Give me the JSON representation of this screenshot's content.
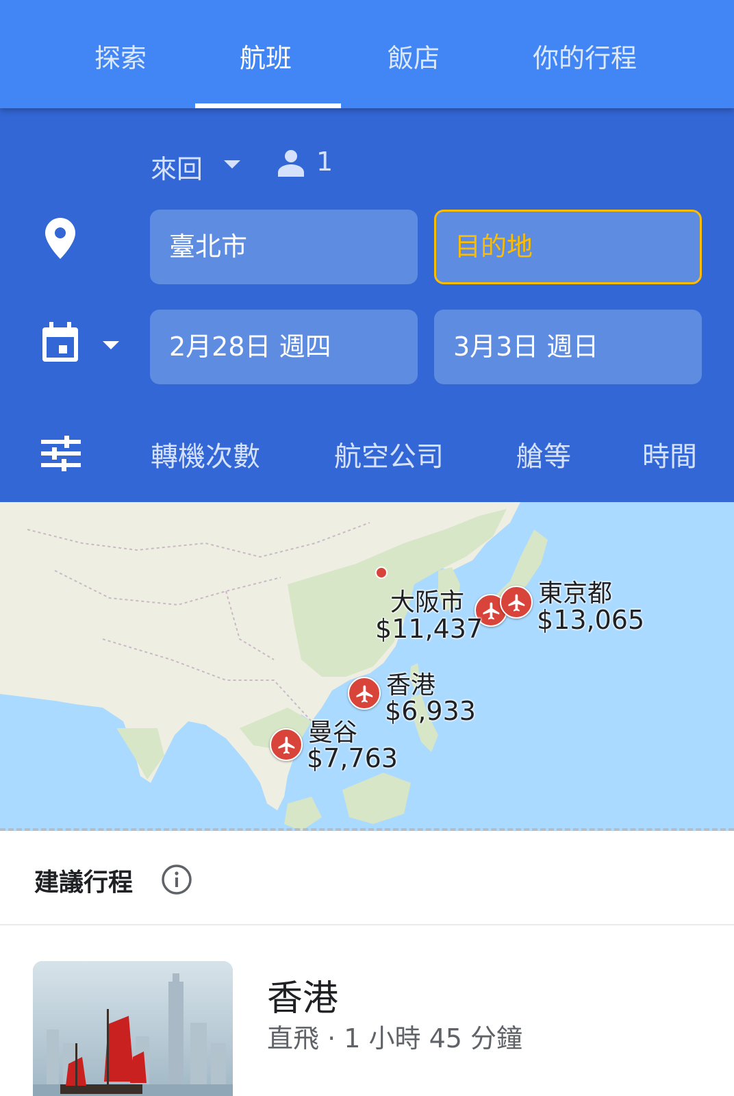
{
  "tabs": [
    {
      "label": "探索",
      "active": false
    },
    {
      "label": "航班",
      "active": true
    },
    {
      "label": "飯店",
      "active": false
    },
    {
      "label": "你的行程",
      "active": false
    }
  ],
  "search": {
    "trip_type": "來回",
    "passengers": "1",
    "origin": "臺北市",
    "destination_placeholder": "目的地",
    "depart_date": "2月28日 週四",
    "return_date": "3月3日 週日"
  },
  "filters": [
    "轉機次數",
    "航空公司",
    "艙等",
    "時間"
  ],
  "map": {
    "destinations": [
      {
        "city": "大阪市",
        "price": "$11,437"
      },
      {
        "city": "東京都",
        "price": "$13,065"
      },
      {
        "city": "香港",
        "price": "$6,933"
      },
      {
        "city": "曼谷",
        "price": "$7,763"
      }
    ]
  },
  "suggestions": {
    "title": "建議行程",
    "items": [
      {
        "name": "香港",
        "meta": "直飛 · 1 小時 45 分鐘"
      }
    ]
  },
  "colors": {
    "tabbar": "#4285f4",
    "panel": "#3367d6",
    "field": "#5e8ce0",
    "destination_accent": "#fbbc05",
    "pin": "#d9443a",
    "sea": "#aadaff"
  },
  "icons": {
    "location": "location-pin-icon",
    "calendar": "calendar-icon",
    "filters": "tune-icon",
    "passenger": "person-icon",
    "info": "info-icon",
    "airport": "airplane-icon"
  }
}
